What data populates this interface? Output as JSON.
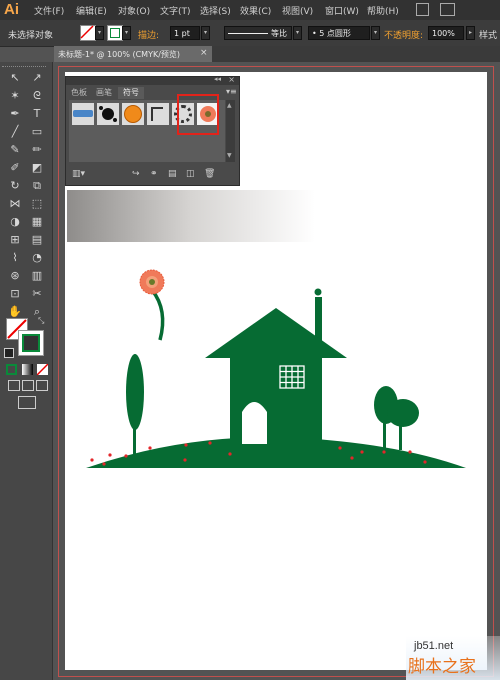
{
  "app": {
    "logo": "Ai"
  },
  "menu": [
    "文件(F)",
    "编辑(E)",
    "对象(O)",
    "文字(T)",
    "选择(S)",
    "效果(C)",
    "视图(V)",
    "窗口(W)",
    "帮助(H)"
  ],
  "control_bar": {
    "selection_label": "未选择对象",
    "stroke_label": "描边:",
    "stroke_weight": "1 pt",
    "stroke_profile": "等比",
    "brush": "5 点圆形",
    "opacity_label": "不透明度:",
    "opacity_value": "100%",
    "style_label": "样式"
  },
  "document_tab": {
    "title": "未标题-1* @ 100% (CMYK/预览)",
    "close": "×"
  },
  "symbols_panel": {
    "tabs": [
      "色板",
      "画笔",
      "符号"
    ],
    "active_tab": "符号",
    "collapse": "◂◂",
    "close": "×",
    "menu": "▾≡",
    "symbols": [
      "banner-symbol",
      "ink-splatter-symbol",
      "orange-button-symbol",
      "corner-symbol",
      "wreath-symbol",
      "gerbera-flower-symbol"
    ],
    "selected_symbol": "gerbera-flower-symbol"
  },
  "colors": {
    "house_green": "#066b33",
    "flower_petals": "#f07a5a",
    "berry_red": "#e3262a",
    "highlight_red": "#e2231a",
    "fill_swatch_stroke": "#0a8a3a"
  },
  "watermark": {
    "site": "jb51.net",
    "name": "脚本之家"
  }
}
